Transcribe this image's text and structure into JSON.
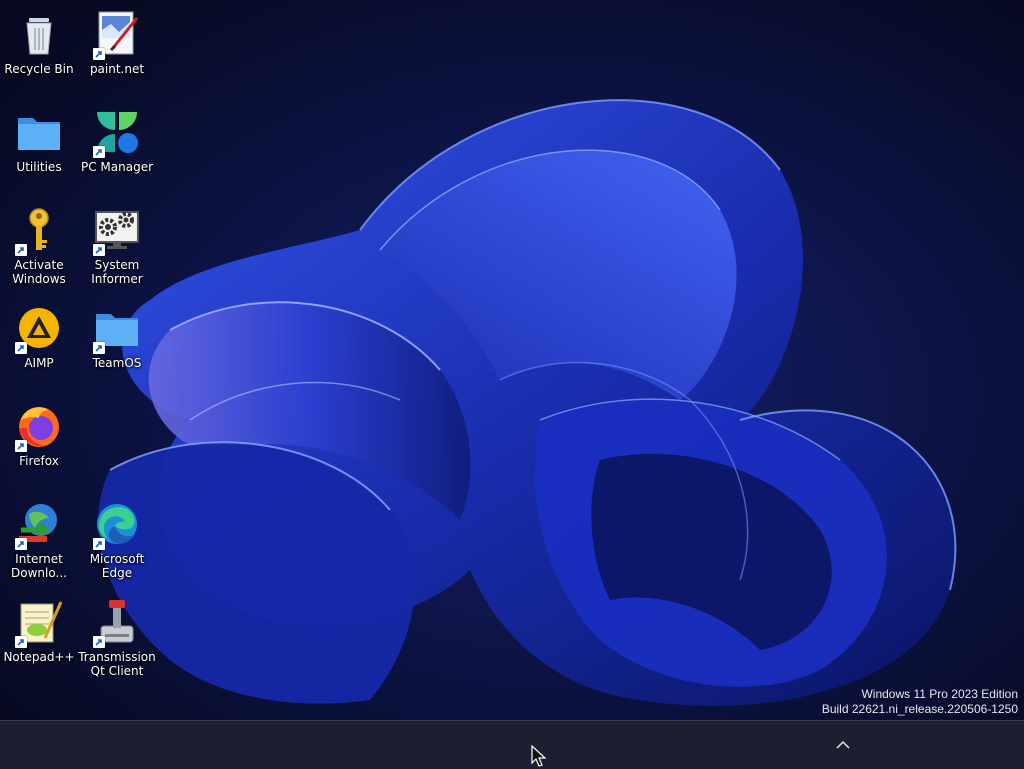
{
  "desktop": {
    "icons": [
      {
        "label": "Recycle Bin",
        "icon": "recycle-bin-icon"
      },
      {
        "label": "paint.net",
        "icon": "paint-net-icon"
      },
      {
        "label": "Utilities",
        "icon": "folder-icon"
      },
      {
        "label": "PC Manager",
        "icon": "pc-manager-icon"
      },
      {
        "label": "Activate Windows",
        "icon": "key-icon"
      },
      {
        "label": "System Informer",
        "icon": "system-informer-icon"
      },
      {
        "label": "AIMP",
        "icon": "aimp-icon"
      },
      {
        "label": "TeamOS",
        "icon": "folder-icon"
      },
      {
        "label": "Firefox",
        "icon": "firefox-icon"
      },
      {
        "label": "Internet Downlo...",
        "icon": "idm-icon"
      },
      {
        "label": "Microsoft Edge",
        "icon": "edge-icon"
      },
      {
        "label": "Notepad++",
        "icon": "notepadpp-icon"
      },
      {
        "label": "Transmission Qt Client",
        "icon": "transmission-icon"
      }
    ]
  },
  "watermark": {
    "line1": "Windows 11 Pro 2023 Edition",
    "line2": "Build 22621.ni_release.220506-1250"
  },
  "taskbar": {
    "tray_chevron": "chevron-up-icon"
  },
  "colors": {
    "wallpaper_dark": "#0a0f2e",
    "bloom_blue": "#1d3bd6",
    "taskbar": "#1c1f30"
  }
}
